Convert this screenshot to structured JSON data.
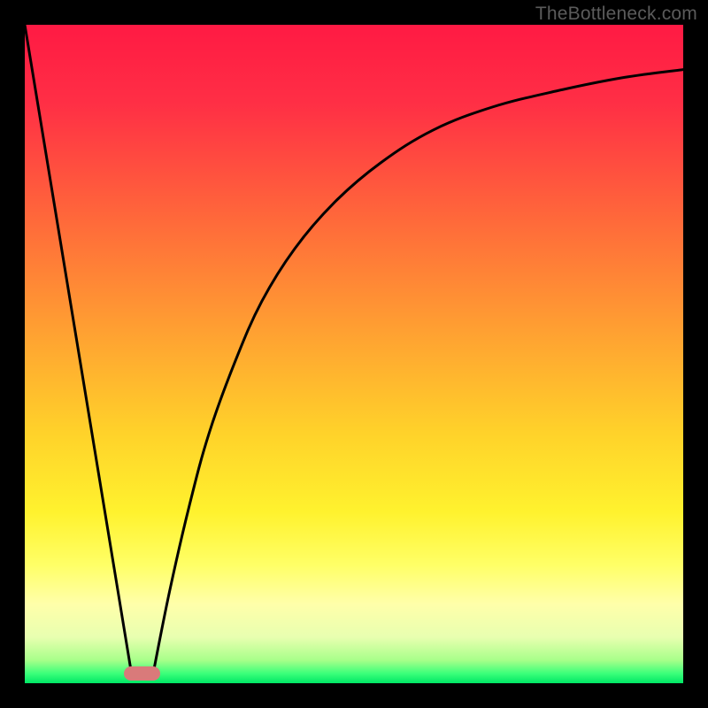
{
  "watermark": "TheBottleneck.com",
  "chart_data": {
    "type": "line",
    "title": "",
    "xlabel": "",
    "ylabel": "",
    "xlim": [
      0,
      100
    ],
    "ylim": [
      0,
      100
    ],
    "grid": false,
    "legend": false,
    "gradient_stops": [
      {
        "offset": 0.0,
        "color": "#ff1a44"
      },
      {
        "offset": 0.12,
        "color": "#ff2f45"
      },
      {
        "offset": 0.3,
        "color": "#ff6a3a"
      },
      {
        "offset": 0.48,
        "color": "#ffa531"
      },
      {
        "offset": 0.62,
        "color": "#ffd22a"
      },
      {
        "offset": 0.74,
        "color": "#fff22e"
      },
      {
        "offset": 0.82,
        "color": "#ffff66"
      },
      {
        "offset": 0.88,
        "color": "#ffffaa"
      },
      {
        "offset": 0.93,
        "color": "#e8ffb0"
      },
      {
        "offset": 0.965,
        "color": "#a8ff8a"
      },
      {
        "offset": 0.985,
        "color": "#3cff7a"
      },
      {
        "offset": 1.0,
        "color": "#00e765"
      }
    ],
    "series": [
      {
        "name": "left-line",
        "x": [
          0,
          16.2
        ],
        "values": [
          100,
          1.5
        ]
      },
      {
        "name": "right-curve",
        "x": [
          19.5,
          22,
          25,
          28,
          32,
          36,
          41,
          47,
          54,
          62,
          71,
          81,
          91,
          100
        ],
        "values": [
          1.5,
          14,
          27,
          38,
          49,
          58,
          66,
          73,
          79,
          84,
          87.5,
          90,
          92,
          93.2
        ]
      }
    ],
    "marker": {
      "name": "bottleneck-marker",
      "x_center": 17.8,
      "width": 5.4,
      "y_center": 1.5,
      "height": 2.1,
      "color": "#d97a7a"
    }
  }
}
